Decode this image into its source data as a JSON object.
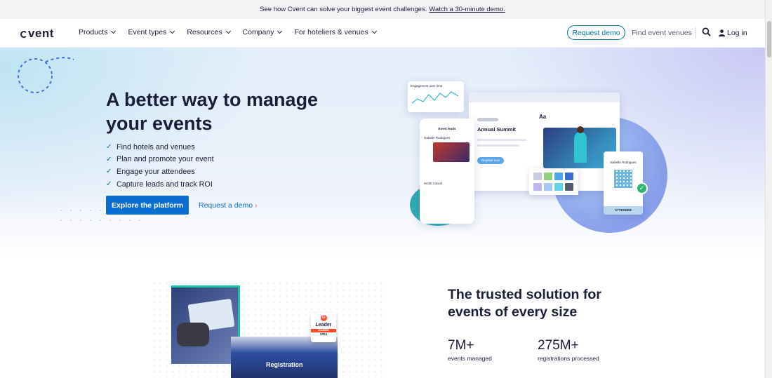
{
  "promo": {
    "text": "See how Cvent can solve your biggest event challenges.",
    "link": "Watch a 30-minute demo."
  },
  "nav": {
    "logo": "vent",
    "menu": [
      {
        "label": "Products"
      },
      {
        "label": "Event types"
      },
      {
        "label": "Resources"
      },
      {
        "label": "Company"
      },
      {
        "label": "For hoteliers & venues"
      }
    ],
    "request_demo": "Request demo",
    "find_venues": "Find event venues",
    "login": "Log in"
  },
  "hero": {
    "title": "A better way to manage your events",
    "bullets": [
      "Find hotels and venues",
      "Plan and promote your event",
      "Engage your attendees",
      "Capture leads and track ROI"
    ],
    "primary_cta": "Explore the platform",
    "secondary_cta": "Request a demo",
    "illustration": {
      "chart_title": "Engagement over time",
      "phone_title": "Event leads",
      "phone_person_1": "Isabelle Rodrigues",
      "phone_person_2": "Smith Carroll",
      "event_title": "Annual Summit",
      "font_label": "Aa",
      "register_label": "Register now",
      "badge_name": "Isabelle Rodrigues",
      "badge_label": "ATTENDEE",
      "swatch_colors": [
        "#c9cde0",
        "#8fd17d",
        "#4ea8e8",
        "#3a6bd6",
        "#bfb5ef",
        "#a4c9f4",
        "#5fd4e8",
        "#555a6e"
      ]
    }
  },
  "lower": {
    "heading": "The trusted solution for events of every size",
    "stats": [
      {
        "value": "7M+",
        "label": "events managed"
      },
      {
        "value": "275M+",
        "label": "registrations processed"
      }
    ],
    "badge": {
      "title": "Leader",
      "season": "SUMMER",
      "year": "2024",
      "g2": "G"
    },
    "photo_caption": "Registration"
  }
}
